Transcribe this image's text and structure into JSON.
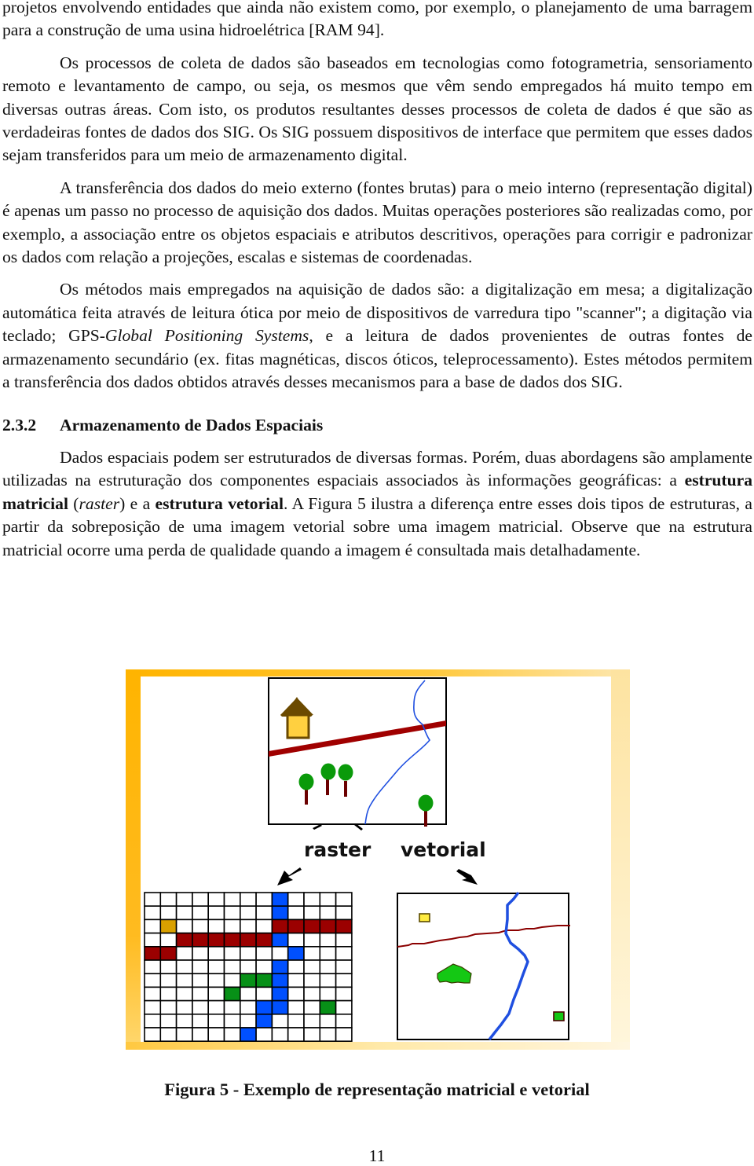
{
  "document": {
    "paragraphs": [
      {
        "id": "p0",
        "continuation": true,
        "runs": [
          {
            "text": "projetos envolvendo entidades que ainda não existem como, por exemplo, o planejamento de uma barragem para a construção de uma usina hidroelétrica [RAM 94]."
          }
        ]
      },
      {
        "id": "p1",
        "runs": [
          {
            "text": "Os processos de coleta de dados são baseados em tecnologias como fotogrametria, sensoriamento remoto e levantamento de campo, ou seja, os mesmos que vêm sendo empregados há muito tempo em diversas outras áreas. Com isto, os produtos resultantes desses processos de coleta de dados é que são as verdadeiras fontes de dados dos SIG. Os SIG possuem dispositivos de interface que permitem que esses dados sejam transferidos para um meio de armazenamento digital."
          }
        ]
      },
      {
        "id": "p2",
        "runs": [
          {
            "text": "A transferência dos dados do meio externo (fontes brutas) para o meio interno (representação digital) é apenas um passo no processo de aquisição dos dados. Muitas operações posteriores são realizadas como, por exemplo, a associação entre os objetos espaciais e atributos descritivos, operações para corrigir e padronizar os dados com relação a projeções, escalas e sistemas de coordenadas."
          }
        ]
      },
      {
        "id": "p3",
        "runs": [
          {
            "text": "Os métodos mais empregados na aquisição de dados são: a digitalização em mesa; a digitalização automática feita através de leitura ótica por meio de dispositivos de varredura tipo \"scanner\"; a digitação via teclado; GPS-"
          },
          {
            "text": "Global Positioning Systems",
            "style": "italic"
          },
          {
            "text": ", e a leitura de dados provenientes de outras fontes de armazenamento secundário (ex. fitas magnéticas, discos óticos, teleprocessamento). Estes métodos permitem a transferência dos dados obtidos através desses mecanismos para a base de dados dos SIG."
          }
        ]
      }
    ],
    "section": {
      "number": "2.3.2",
      "title": "Armazenamento de Dados Espaciais"
    },
    "section_paragraphs": [
      {
        "id": "p4",
        "runs": [
          {
            "text": "Dados espaciais podem ser estruturados de diversas formas. Porém, duas abordagens são amplamente utilizadas na estruturação dos componentes espaciais associados às informações geográficas: a "
          },
          {
            "text": "estrutura matricial",
            "style": "bold"
          },
          {
            "text": " ("
          },
          {
            "text": "raster",
            "style": "italic"
          },
          {
            "text": ") e a "
          },
          {
            "text": "estrutura vetorial",
            "style": "bold"
          },
          {
            "text": ". A Figura 5 ilustra a diferença entre esses dois tipos de estruturas, a partir da sobreposição de uma imagem vetorial sobre uma imagem matricial. Observe que na estrutura matricial ocorre uma perda de qualidade quando a imagem é consultada mais detalhadamente."
          }
        ]
      }
    ],
    "figure": {
      "label_raster": "raster",
      "label_vector": "vetorial",
      "caption": "Figura 5 - Exemplo de representação matricial e vetorial",
      "colors": {
        "frame_orange": "#ffb400",
        "frame_pale": "#fde9b0",
        "road": "#a00000",
        "river": "#1f4fe0",
        "tree_crown": "#0a9a0a",
        "tree_trunk": "#6b0000",
        "house_roof": "#6b4a00",
        "house_body": "#ffd040",
        "raster_gold": "#d9a000",
        "raster_red": "#9b0000",
        "raster_blue": "#0050ff",
        "raster_green": "#079017",
        "vector_green": "#14c814",
        "vector_yellow": "#ffec40",
        "grid_line": "#000000"
      },
      "raster_grid": {
        "cols": 13,
        "rows": 11,
        "cells": [
          {
            "r": 0,
            "c": 8,
            "k": "blue"
          },
          {
            "r": 1,
            "c": 8,
            "k": "blue"
          },
          {
            "r": 2,
            "c": 1,
            "k": "gold"
          },
          {
            "r": 2,
            "c": 8,
            "k": "red"
          },
          {
            "r": 2,
            "c": 9,
            "k": "red"
          },
          {
            "r": 2,
            "c": 10,
            "k": "red"
          },
          {
            "r": 2,
            "c": 11,
            "k": "red"
          },
          {
            "r": 2,
            "c": 12,
            "k": "red"
          },
          {
            "r": 3,
            "c": 2,
            "k": "red"
          },
          {
            "r": 3,
            "c": 3,
            "k": "red"
          },
          {
            "r": 3,
            "c": 4,
            "k": "red"
          },
          {
            "r": 3,
            "c": 5,
            "k": "red"
          },
          {
            "r": 3,
            "c": 6,
            "k": "red"
          },
          {
            "r": 3,
            "c": 7,
            "k": "red"
          },
          {
            "r": 3,
            "c": 8,
            "k": "blue"
          },
          {
            "r": 4,
            "c": 0,
            "k": "red"
          },
          {
            "r": 4,
            "c": 1,
            "k": "red"
          },
          {
            "r": 4,
            "c": 9,
            "k": "blue"
          },
          {
            "r": 5,
            "c": 8,
            "k": "blue"
          },
          {
            "r": 6,
            "c": 6,
            "k": "green"
          },
          {
            "r": 6,
            "c": 7,
            "k": "green"
          },
          {
            "r": 6,
            "c": 8,
            "k": "blue"
          },
          {
            "r": 7,
            "c": 5,
            "k": "green"
          },
          {
            "r": 7,
            "c": 8,
            "k": "blue"
          },
          {
            "r": 8,
            "c": 7,
            "k": "blue"
          },
          {
            "r": 8,
            "c": 8,
            "k": "blue"
          },
          {
            "r": 8,
            "c": 11,
            "k": "green"
          },
          {
            "r": 9,
            "c": 7,
            "k": "blue"
          },
          {
            "r": 10,
            "c": 6,
            "k": "blue"
          }
        ]
      }
    },
    "page_number": "11"
  }
}
